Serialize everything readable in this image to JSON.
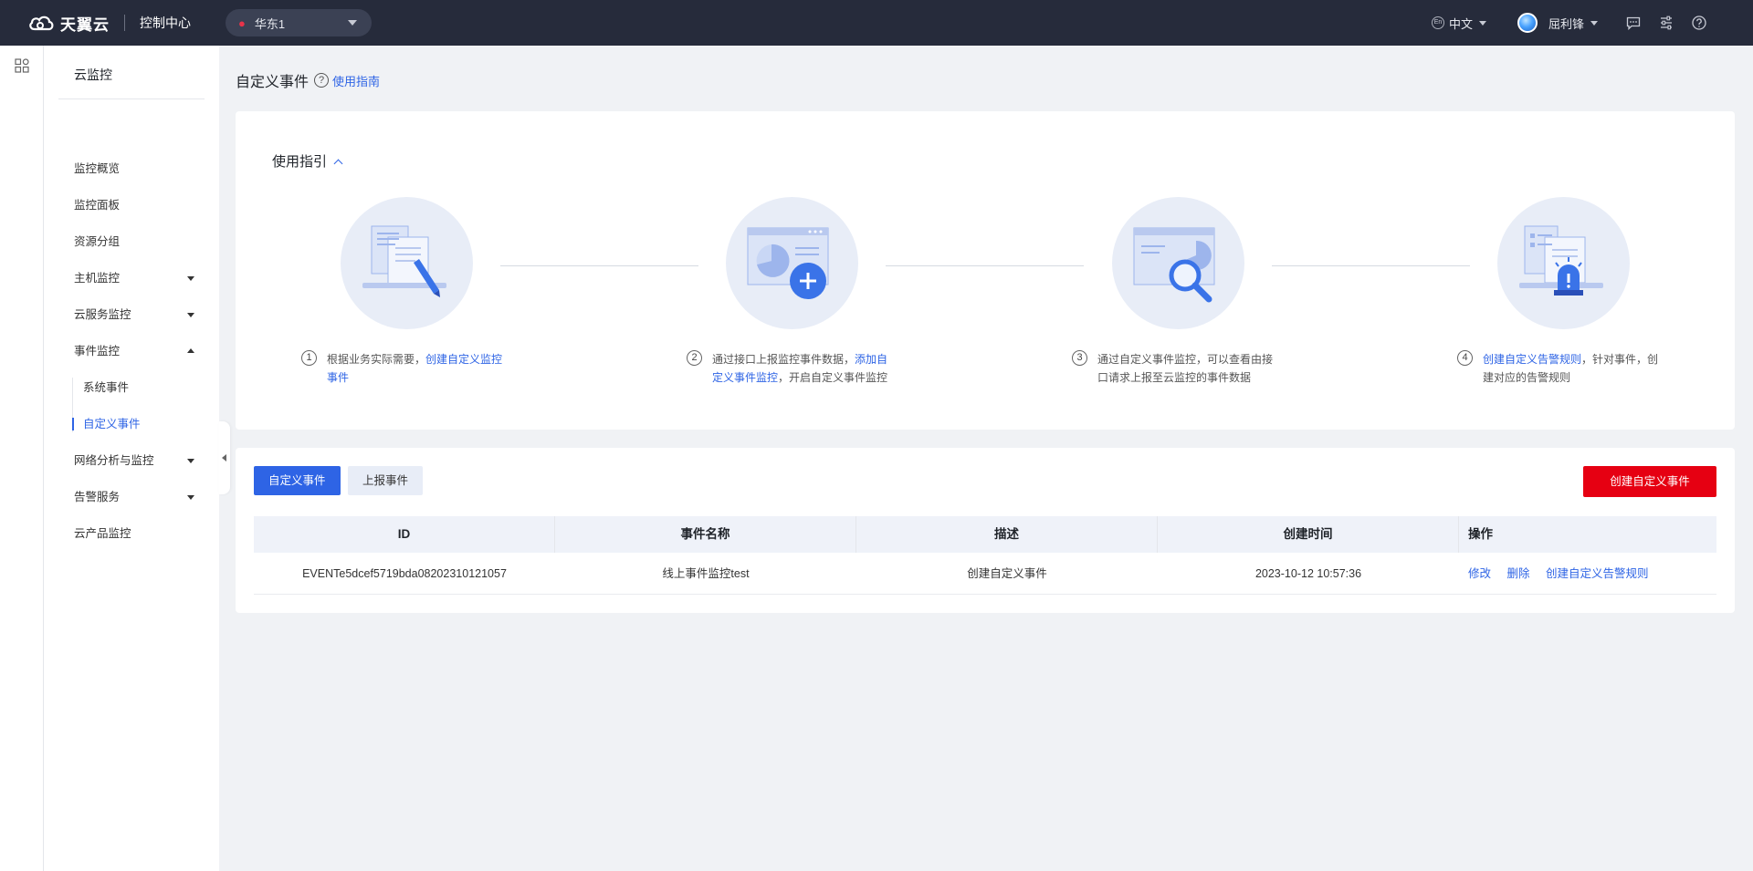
{
  "topbar": {
    "brand": "天翼云",
    "console": "控制中心",
    "region": "华东1",
    "language": "中文",
    "username": "屈利锋"
  },
  "sidebar": {
    "title": "云监控",
    "items": [
      {
        "label": "监控概览"
      },
      {
        "label": "监控面板"
      },
      {
        "label": "资源分组"
      },
      {
        "label": "主机监控"
      },
      {
        "label": "云服务监控"
      },
      {
        "label": "事件监控"
      },
      {
        "label": "网络分析与监控"
      },
      {
        "label": "告警服务"
      },
      {
        "label": "云产品监控"
      }
    ],
    "event_sub": [
      {
        "label": "系统事件"
      },
      {
        "label": "自定义事件"
      }
    ]
  },
  "page": {
    "title": "自定义事件",
    "help_link": "使用指南"
  },
  "guide": {
    "title": "使用指引",
    "steps": [
      {
        "num": "1",
        "pre": "根据业务实际需要，",
        "link": "创建自定义监控事件",
        "post": ""
      },
      {
        "num": "2",
        "pre": "通过接口上报监控事件数据，",
        "link": "添加自定义事件监控",
        "post": "，开启自定义事件监控"
      },
      {
        "num": "3",
        "pre": "通过自定义事件监控，可以查看由接口请求上报至云监控的事件数据",
        "link": "",
        "post": ""
      },
      {
        "num": "4",
        "pre": "",
        "link": "创建自定义告警规则",
        "post": "，针对事件，创建对应的告警规则"
      }
    ]
  },
  "list": {
    "tab_active": "自定义事件",
    "tab_inactive": "上报事件",
    "create_button": "创建自定义事件",
    "columns": [
      "ID",
      "事件名称",
      "描述",
      "创建时间",
      "操作"
    ],
    "rows": [
      {
        "id": "EVENTe5dcef5719bda08202310121057",
        "name": "线上事件监控test",
        "desc": "创建自定义事件",
        "created": "2023-10-12 10:57:36",
        "ops": [
          "修改",
          "删除",
          "创建自定义告警规则"
        ]
      }
    ]
  },
  "colors": {
    "topbar": "#262b3b",
    "accent": "#2e64e5",
    "danger": "#e60012"
  }
}
